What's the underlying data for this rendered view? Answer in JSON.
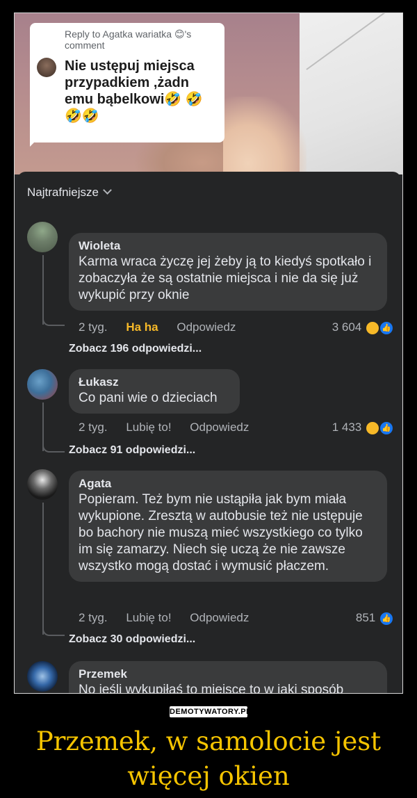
{
  "reply_card": {
    "header": "Reply to Agatka wariatka 😊's comment",
    "text": "Nie ustępuj miejsca przypadkiem ,żadn emu bąbelkowi🤣 🤣🤣🤣"
  },
  "sort_label": "Najtrafniejsze",
  "comments": [
    {
      "author": "Wioleta",
      "text": "Karma wraca życzę jej żeby ją to kiedyś spotkało i zobaczyła że są ostatnie miejsca i nie da się już wykupić przy oknie",
      "time": "2 tyg.",
      "reaction": "Ha ha",
      "reply": "Odpowiedz",
      "count": "3 604",
      "see_replies": "Zobacz 196 odpowiedzi..."
    },
    {
      "author": "Łukasz",
      "text": "Co pani wie o dzieciach",
      "time": "2 tyg.",
      "reaction": "Lubię to!",
      "reply": "Odpowiedz",
      "count": "1 433",
      "see_replies": "Zobacz 91 odpowiedzi..."
    },
    {
      "author": "Agata",
      "text": "Popieram. Też bym nie ustąpiła jak bym miała wykupione. Zresztą w autobusie też nie ustępuje bo bachory nie muszą mieć wszystkiego co tylko im się zamarzy. Niech się uczą że nie zawsze wszystko mogą dostać i wymusić płaczem.",
      "time": "2 tyg.",
      "reaction": "Lubię to!",
      "reply": "Odpowiedz",
      "count": "851",
      "see_replies": "Zobacz 30 odpowiedzi..."
    },
    {
      "author": "Przemek",
      "text": "No jeśli wykupiłaś to miejsce to w jaki sposób rodzic ma lwykupić je swojemu dziecku 🤯🤯"
    }
  ],
  "watermark": "DEMOTYWATORY.PL",
  "caption": "Przemek, w samolocie jest więcej okien",
  "colors": {
    "accent_reaction": "#f7b928",
    "like_blue": "#1877f2",
    "caption": "#f5c400"
  }
}
